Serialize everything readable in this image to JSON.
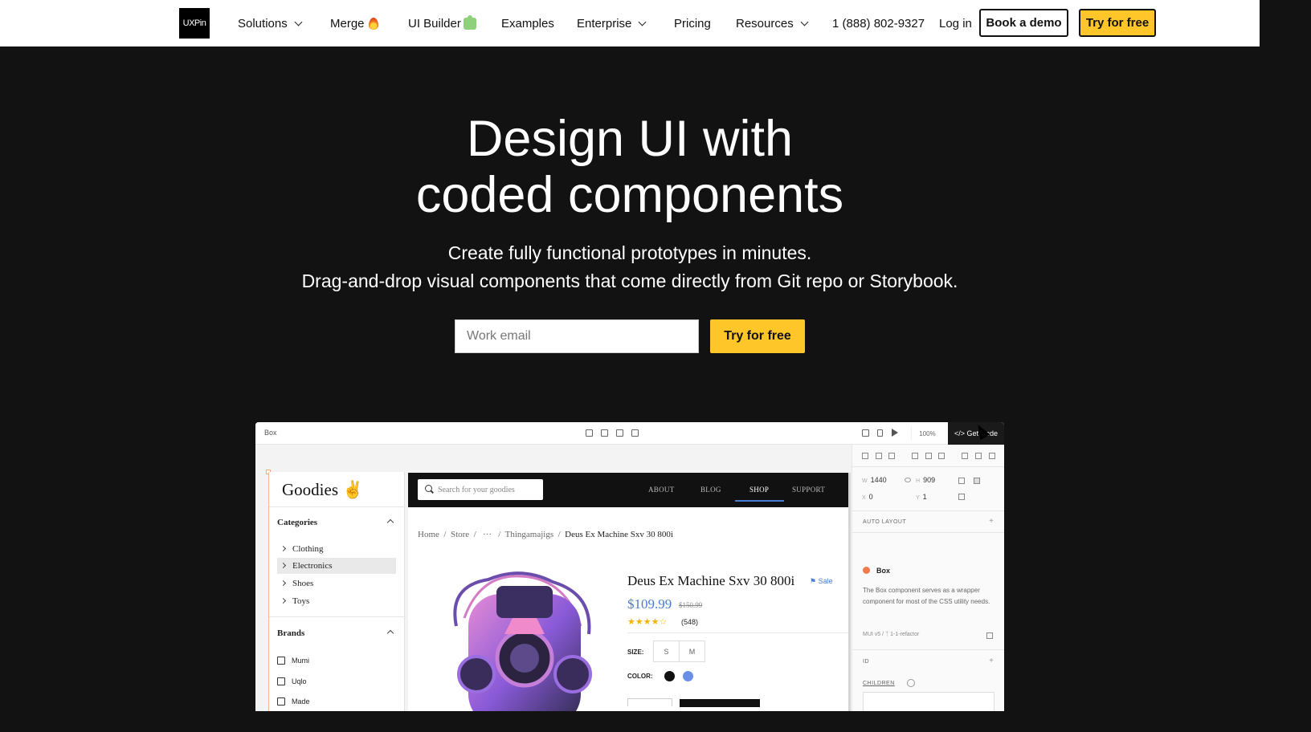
{
  "nav": {
    "logo": "UXPin",
    "items": [
      {
        "label": "Solutions",
        "dropdown": true
      },
      {
        "label": "Merge",
        "icon": "fire-icon"
      },
      {
        "label": "UI Builder",
        "icon": "puzzle-icon"
      },
      {
        "label": "Examples"
      },
      {
        "label": "Enterprise",
        "dropdown": true
      },
      {
        "label": "Pricing"
      },
      {
        "label": "Resources",
        "dropdown": true
      }
    ],
    "phone": "1 (888) 802-9327",
    "login": "Log in",
    "book_demo": "Book a demo",
    "try_free": "Try for free"
  },
  "hero": {
    "title_line1": "Design UI with",
    "title_line2": "coded components",
    "subtitle_line1": "Create fully functional prototypes in minutes.",
    "subtitle_line2": "Drag-and-drop visual components that come directly from Git repo or Storybook.",
    "email_placeholder": "Work email",
    "cta": "Try for free"
  },
  "editor": {
    "title": "Box",
    "zoom": "100%",
    "get_code": "</> Get Code",
    "app": {
      "brand": "Goodies ✌",
      "categories_title": "Categories",
      "categories": [
        "Clothing",
        "Electronics",
        "Shoes",
        "Toys"
      ],
      "active_category": "Electronics",
      "brands_title": "Brands",
      "brands": [
        "Mumi",
        "Uqlo",
        "Made"
      ],
      "search_placeholder": "Search for your goodies",
      "menu": [
        "ABOUT",
        "BLOG",
        "SHOP",
        "SUPPORT"
      ],
      "breadcrumbs": [
        "Home",
        "Store",
        "···",
        "Thingamajigs",
        "Deus Ex Machine Sxv 30 800i"
      ],
      "product": {
        "title": "Deus Ex Machine Sxv 30 800i",
        "sale": "Sale",
        "price": "$109.99",
        "old_price": "$150.99",
        "stars": "★★★★☆",
        "reviews": "(548)",
        "size_label": "SIZE:",
        "sizes": [
          "S",
          "M"
        ],
        "color_label": "COLOR:",
        "colors": [
          "#111111",
          "#6b8fe8"
        ]
      }
    },
    "panel": {
      "w_label": "W",
      "w": "1440",
      "h_label": "H",
      "h": "909",
      "x_label": "X",
      "x": "0",
      "y_label": "Y",
      "y": "1",
      "auto_layout": "AUTO LAYOUT",
      "component_name": "Box",
      "component_desc": "The Box component serves as a wrapper component for most of the CSS utility needs.",
      "meta_lib": "MUI v5",
      "meta_branch": "1-1-refactor",
      "id_label": "ID",
      "children_label": "CHILDREN"
    }
  }
}
